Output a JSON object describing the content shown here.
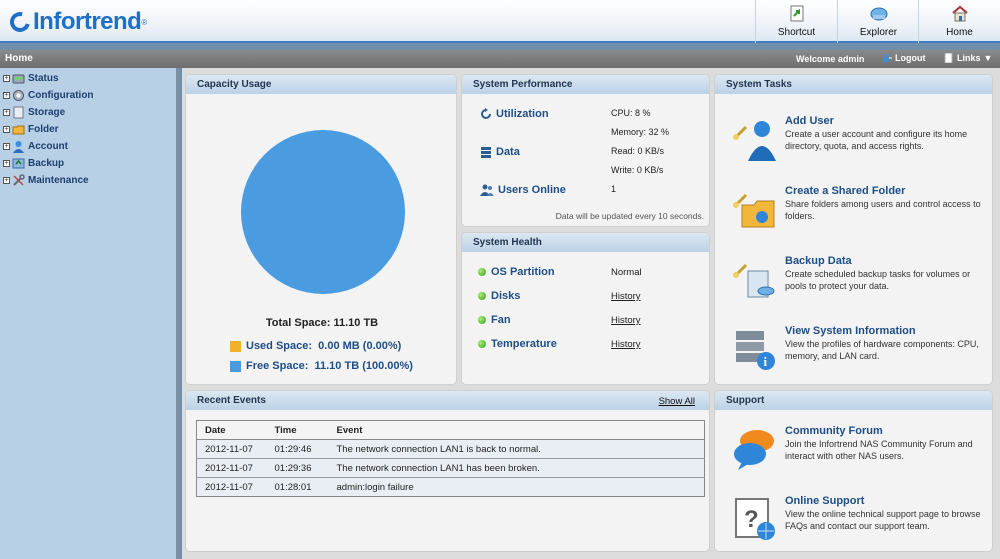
{
  "header": {
    "logo": "Infortrend",
    "buttons": [
      {
        "label": "Shortcut",
        "icon": "shortcut-icon"
      },
      {
        "label": "Explorer",
        "icon": "explorer-icon"
      },
      {
        "label": "Home",
        "icon": "home-icon"
      }
    ]
  },
  "navbar": {
    "breadcrumb": "Home",
    "welcome": "Welcome admin",
    "logout": "Logout",
    "links": "Links"
  },
  "sidebar": {
    "items": [
      {
        "label": "Status",
        "icon": "status-icon"
      },
      {
        "label": "Configuration",
        "icon": "configuration-icon"
      },
      {
        "label": "Storage",
        "icon": "storage-icon"
      },
      {
        "label": "Folder",
        "icon": "folder-icon"
      },
      {
        "label": "Account",
        "icon": "account-icon"
      },
      {
        "label": "Backup",
        "icon": "backup-icon"
      },
      {
        "label": "Maintenance",
        "icon": "maintenance-icon"
      }
    ]
  },
  "capacity": {
    "title": "Capacity Usage",
    "total": "Total Space: 11.10 TB",
    "used_label": "Used Space:",
    "used_value": "0.00 MB (0.00%)",
    "free_label": "Free Space:",
    "free_value": "11.10 TB (100.00%)",
    "used_fraction": 0.0,
    "colors": {
      "used": "#f1b12a",
      "free": "#4a9be0"
    }
  },
  "performance": {
    "title": "System Performance",
    "utilization": "Utilization",
    "cpu": "CPU: 8 %",
    "memory": "Memory: 32 %",
    "data": "Data",
    "read": "Read: 0 KB/s",
    "write": "Write: 0 KB/s",
    "users_online": "Users Online",
    "users_count": "1",
    "note": "Data will be updated every 10 seconds."
  },
  "health": {
    "title": "System Health",
    "rows": [
      {
        "label": "OS Partition",
        "value": "Normal"
      },
      {
        "label": "Disks",
        "value": "History"
      },
      {
        "label": "Fan",
        "value": "History"
      },
      {
        "label": "Temperature",
        "value": "History"
      }
    ]
  },
  "tasks": {
    "title": "System Tasks",
    "items": [
      {
        "title": "Add User",
        "desc": "Create a user account and configure its home directory, quota, and access rights."
      },
      {
        "title": "Create a Shared Folder",
        "desc": "Share folders among users and control access to folders."
      },
      {
        "title": "Backup Data",
        "desc": "Create scheduled backup tasks for volumes or pools to protect your data."
      },
      {
        "title": "View System Information",
        "desc": "View the profiles of hardware components: CPU, memory, and LAN card."
      }
    ]
  },
  "events": {
    "title": "Recent Events",
    "show_all": "Show All",
    "columns": [
      "Date",
      "Time",
      "Event"
    ],
    "rows": [
      [
        "2012-11-07",
        "01:29:46",
        "The network connection LAN1 is back to normal."
      ],
      [
        "2012-11-07",
        "01:29:36",
        "The network connection LAN1 has been broken."
      ],
      [
        "2012-11-07",
        "01:28:01",
        "admin:login failure"
      ]
    ]
  },
  "support": {
    "title": "Support",
    "items": [
      {
        "title": "Community Forum",
        "desc": "Join the Infortrend NAS Community Forum and interact with other NAS users."
      },
      {
        "title": "Online Support",
        "desc": "View the online technical support page to browse FAQs and contact our support team."
      }
    ]
  }
}
